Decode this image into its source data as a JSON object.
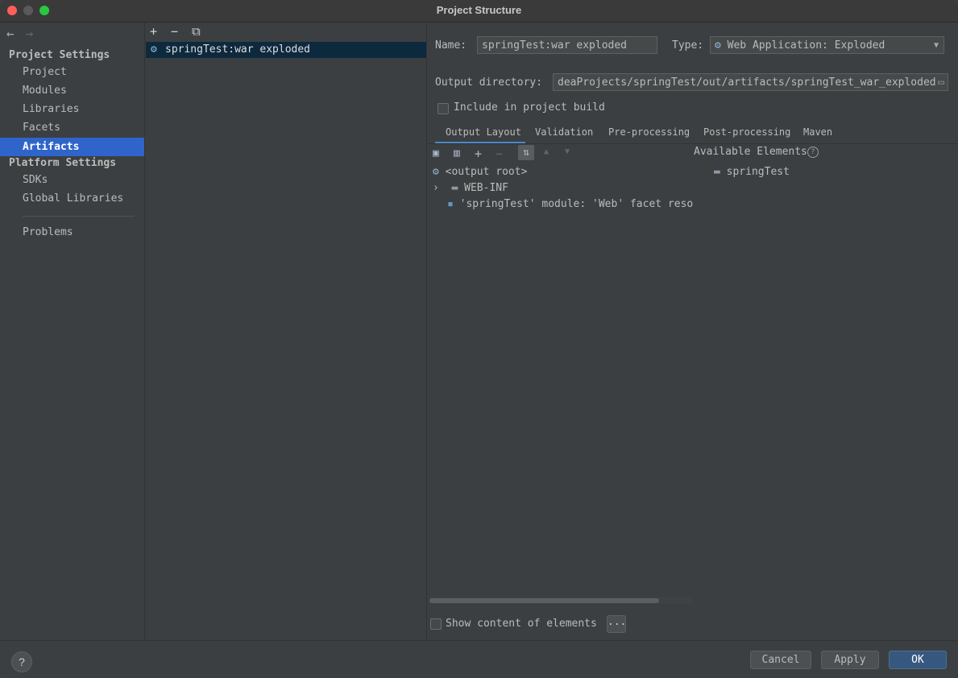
{
  "window": {
    "title": "Project Structure"
  },
  "nav": {
    "back_icon": "arrow-left-icon",
    "forward_icon": "arrow-right-icon",
    "project_settings_header": "Project Settings",
    "project_settings_items": [
      "Project",
      "Modules",
      "Libraries",
      "Facets",
      "Artifacts"
    ],
    "platform_settings_header": "Platform Settings",
    "platform_settings_items": [
      "SDKs",
      "Global Libraries"
    ],
    "problems": "Problems",
    "selected": "Artifacts"
  },
  "artifacts": {
    "toolbar": [
      "+",
      "−",
      "⧉"
    ],
    "list": [
      "springTest:war exploded"
    ]
  },
  "detail": {
    "name_label": "Name:",
    "name_value": "springTest:war exploded",
    "type_label": "Type:",
    "type_value": "Web Application: Exploded",
    "output_label": "Output directory:",
    "output_value": "deaProjects/springTest/out/artifacts/springTest_war_exploded",
    "include_label": "Include in project build",
    "include_checked": false,
    "tabs": [
      "Output Layout",
      "Validation",
      "Pre-processing",
      "Post-processing",
      "Maven"
    ],
    "active_tab": "Output Layout",
    "tree": {
      "root": "<output root>",
      "webinf": "WEB-INF",
      "module_item": "'springTest' module: 'Web' facet resources"
    },
    "available_label": "Available Elements",
    "available_items": [
      "springTest"
    ],
    "show_content_label": "Show content of elements",
    "show_content_checked": false,
    "ellipsis_button": "..."
  },
  "footer": {
    "help": "?",
    "cancel": "Cancel",
    "apply": "Apply",
    "ok": "OK"
  },
  "colors": {
    "selection": "#2f65ca",
    "list_selection": "#0d293e",
    "ok_button": "#365880",
    "tab_underline": "#4a88c7"
  }
}
